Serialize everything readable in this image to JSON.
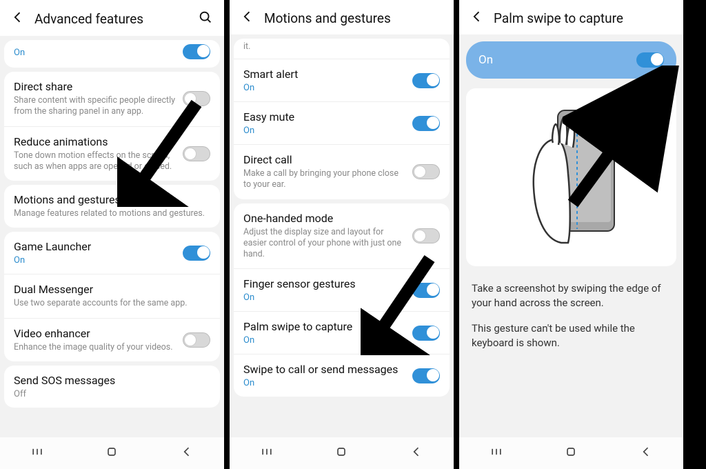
{
  "screens": {
    "advanced": {
      "title": "Advanced features",
      "top_on": "On",
      "direct_share": {
        "title": "Direct share",
        "desc": "Share content with specific people directly from the sharing panel in any app."
      },
      "reduce_anim": {
        "title": "Reduce animations",
        "desc": "Tone down motion effects on the screen, such as when apps are opened or closed."
      },
      "motions": {
        "title": "Motions and gestures",
        "desc": "Manage features related to motions and gestures."
      },
      "game_launcher": {
        "title": "Game Launcher",
        "status": "On"
      },
      "dual_msg": {
        "title": "Dual Messenger",
        "desc": "Use two separate accounts for the same app."
      },
      "video_enh": {
        "title": "Video enhancer",
        "desc": "Enhance the image quality of your videos."
      },
      "sos": {
        "title": "Send SOS messages",
        "status": "Off"
      }
    },
    "motions": {
      "title": "Motions and gestures",
      "truncated": "it.",
      "smart_alert": {
        "title": "Smart alert",
        "status": "On"
      },
      "easy_mute": {
        "title": "Easy mute",
        "status": "On"
      },
      "direct_call": {
        "title": "Direct call",
        "desc": "Make a call by bringing your phone close to your ear."
      },
      "one_handed": {
        "title": "One-handed mode",
        "desc": "Adjust the display size and layout for easier control of your phone with just one hand."
      },
      "finger_sensor": {
        "title": "Finger sensor gestures",
        "status": "On"
      },
      "palm_swipe": {
        "title": "Palm swipe to capture",
        "status": "On"
      },
      "swipe_call": {
        "title": "Swipe to call or send messages",
        "status": "On"
      }
    },
    "palm": {
      "title": "Palm swipe to capture",
      "banner_label": "On",
      "desc1": "Take a screenshot by swiping the edge of your hand across the screen.",
      "desc2": "This gesture can't be used while the keyboard is shown."
    }
  }
}
